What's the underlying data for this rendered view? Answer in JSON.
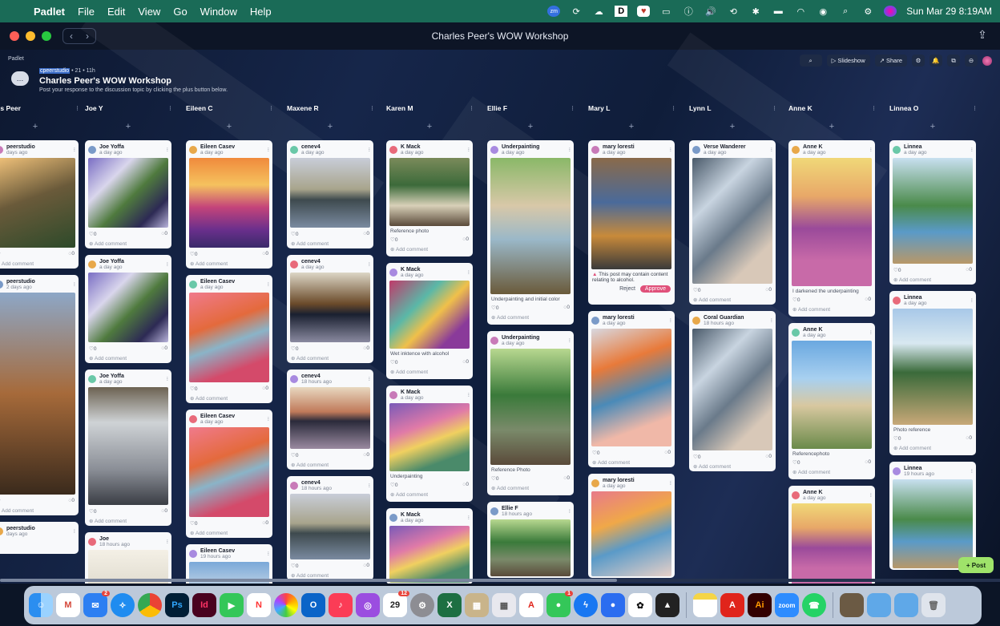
{
  "menubar": {
    "app": "Padlet",
    "items": [
      "File",
      "Edit",
      "View",
      "Go",
      "Window",
      "Help"
    ],
    "clock": "Sun Mar 29  8:19AM"
  },
  "window": {
    "title": "Charles Peer's WOW Workshop"
  },
  "padlet": {
    "brand": "Padlet",
    "meta_user": "cpeerstudio",
    "meta_rest": " • 21 • 11h",
    "title": "Charles Peer's WOW Workshop",
    "description": "Post your response to the discussion topic by clicking the plus button below.",
    "toolbar": {
      "slideshow": "Slideshow",
      "share": "Share"
    },
    "post_button": "+ Post"
  },
  "columns": [
    {
      "name": "rles Peer",
      "cards": [
        {
          "author": "peerstudio",
          "time": "days ago",
          "likes": "",
          "comments": "0",
          "add": "Add comment",
          "image": "house",
          "h": 160
        },
        {
          "author": "peerstudio",
          "time": "2 days ago",
          "likes": "",
          "comments": "0",
          "add": "Add comment",
          "image": "tracks",
          "h": 300
        },
        {
          "author": "peerstudio",
          "time": "days ago",
          "likes": "",
          "comments": "",
          "add": "",
          "image": "",
          "h": 40
        }
      ]
    },
    {
      "name": "Joe Y",
      "cards": [
        {
          "author": "Joe Yoffa",
          "time": "a day ago",
          "likes": "0",
          "comments": "0",
          "add": "Add comment",
          "image": "purple",
          "h": 135
        },
        {
          "author": "Joe Yoffa",
          "time": "a day ago",
          "likes": "0",
          "comments": "0",
          "add": "Add comment",
          "image": "purple",
          "h": 135
        },
        {
          "author": "Joe Yoffa",
          "time": "a day ago",
          "likes": "0",
          "comments": "0",
          "add": "Add comment",
          "image": "laptop",
          "h": 195
        },
        {
          "author": "Joe",
          "time": "18 hours ago",
          "likes": "",
          "comments": "",
          "add": "",
          "image": "white",
          "h": 70
        }
      ]
    },
    {
      "name": "Eileen C",
      "cards": [
        {
          "author": "Eileen Casev",
          "time": "a day ago",
          "likes": "0",
          "comments": "0",
          "add": "Add comment",
          "image": "sunset",
          "h": 160
        },
        {
          "author": "Eileen Casev",
          "time": "a day ago",
          "likes": "0",
          "comments": "0",
          "add": "Add comment",
          "image": "pinkriver",
          "h": 160
        },
        {
          "author": "Eileen Casev",
          "time": "a day ago",
          "likes": "0",
          "comments": "0",
          "add": "Add comment",
          "image": "pinkriver",
          "h": 160
        },
        {
          "author": "Eileen Casev",
          "time": "19 hours ago",
          "likes": "",
          "comments": "",
          "add": "",
          "image": "blue",
          "h": 60
        }
      ]
    },
    {
      "name": "Maxene R",
      "cards": [
        {
          "author": "cenev4",
          "time": "a day ago",
          "likes": "0",
          "comments": "0",
          "add": "Add comment",
          "image": "lake",
          "h": 135
        },
        {
          "author": "cenev4",
          "time": "a day ago",
          "likes": "0",
          "comments": "0",
          "add": "Add comment",
          "image": "lake2",
          "h": 135
        },
        {
          "author": "cenev4",
          "time": "18 hours ago",
          "likes": "0",
          "comments": "0",
          "add": "Add comment",
          "image": "lake3",
          "h": 125
        },
        {
          "author": "cenev4",
          "time": "18 hours ago",
          "likes": "0",
          "comments": "0",
          "add": "Add comment",
          "image": "lake",
          "h": 130
        }
      ]
    },
    {
      "name": "Karen M",
      "cards": [
        {
          "author": "K Mack",
          "time": "a day ago",
          "likes": "0",
          "comments": "0",
          "add": "Add comment",
          "image": "photo",
          "caption": "Reference photo",
          "h": 145
        },
        {
          "author": "K Mack",
          "time": "a day ago",
          "likes": "0",
          "comments": "0",
          "add": "Add comment",
          "image": "ink",
          "caption": "Wet inktence with alcohol",
          "h": 145
        },
        {
          "author": "K Mack",
          "time": "a day ago",
          "likes": "0",
          "comments": "0",
          "add": "Add comment",
          "image": "deer",
          "caption": "Underpainting",
          "h": 145
        },
        {
          "author": "K Mack",
          "time": "a day ago",
          "likes": "",
          "comments": "",
          "add": "",
          "image": "deer",
          "h": 95
        }
      ]
    },
    {
      "name": "Ellie F",
      "cards": [
        {
          "author": "Underpainting",
          "time": "a day ago",
          "likes": "0",
          "comments": "0",
          "add": "Add comment",
          "image": "stream",
          "caption": "Underpainting and initial color",
          "h": 230
        },
        {
          "author": "Underpainting",
          "time": "a day ago",
          "likes": "0",
          "comments": "0",
          "add": "Add comment",
          "image": "forest",
          "caption": "Reference Photo",
          "h": 205
        },
        {
          "author": "Ellie F",
          "time": "18 hours ago",
          "likes": "",
          "comments": "",
          "add": "",
          "image": "forest",
          "h": 95
        }
      ]
    },
    {
      "name": "Mary L",
      "cards": [
        {
          "author": "mary loresti",
          "time": "a day ago",
          "likes": "",
          "comments": "",
          "add": "",
          "image": "drink",
          "warning": "This post may contain content relating to alcohol.",
          "reject": "Reject",
          "approve": "Approve",
          "h": 205
        },
        {
          "author": "mary loresti",
          "time": "a day ago",
          "likes": "0",
          "comments": "0",
          "add": "Add comment",
          "image": "glass",
          "h": 195
        },
        {
          "author": "mary loresti",
          "time": "a day ago",
          "likes": "",
          "comments": "",
          "add": "",
          "image": "glass2",
          "h": 130
        }
      ]
    },
    {
      "name": "Lynn L",
      "cards": [
        {
          "author": "Verse Wanderer",
          "time": "a day ago",
          "likes": "0",
          "comments": "0",
          "add": "Add comment",
          "image": "stone",
          "h": 205
        },
        {
          "author": "Coral Guardian",
          "time": "18 hours ago",
          "likes": "0",
          "comments": "0",
          "add": "Add comment",
          "image": "stone",
          "h": 200
        }
      ]
    },
    {
      "name": "Anne K",
      "cards": [
        {
          "author": "Anne K",
          "time": "a day ago",
          "likes": "0",
          "comments": "0",
          "add": "Add comment",
          "image": "dunes",
          "caption": "I darkened the underpainting",
          "h": 220
        },
        {
          "author": "Anne K",
          "time": "a day ago",
          "likes": "0",
          "comments": "0",
          "add": "Add comment",
          "image": "beach",
          "caption": "Referencephoto",
          "h": 195
        },
        {
          "author": "Anne K",
          "time": "a day ago",
          "likes": "",
          "comments": "",
          "add": "",
          "image": "dunes",
          "h": 125
        }
      ]
    },
    {
      "name": "Linnea O",
      "cards": [
        {
          "author": "Linnea",
          "time": "a day ago",
          "likes": "0",
          "comments": "0",
          "add": "Add comment",
          "image": "tree",
          "h": 180
        },
        {
          "author": "Linnea",
          "time": "a day ago",
          "likes": "0",
          "comments": "0",
          "add": "Add comment",
          "image": "tree2",
          "caption": "Photo reference",
          "h": 205
        },
        {
          "author": "Linnea",
          "time": "19 hours ago",
          "likes": "",
          "comments": "",
          "add": "",
          "image": "tree",
          "h": 135
        }
      ]
    }
  ],
  "dock": {
    "calendar_day": "29",
    "mail_badge": "2",
    "messages_badge": "1",
    "calendar_badge": "12"
  }
}
